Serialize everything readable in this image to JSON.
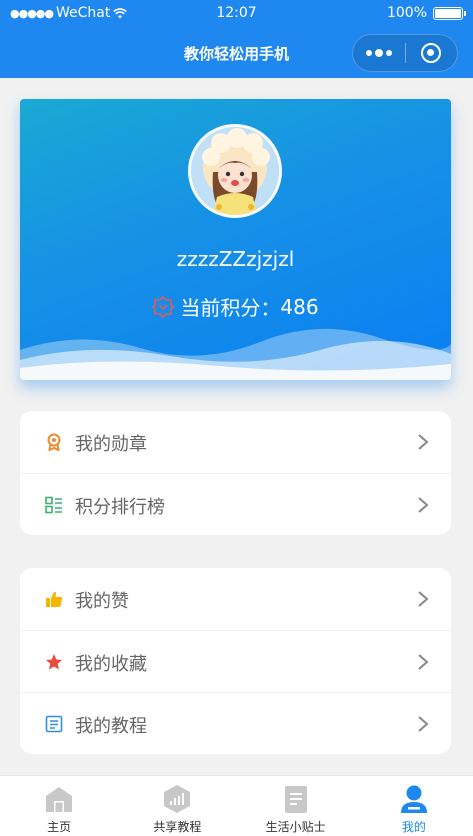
{
  "status_bar": {
    "signal": "●●●●●",
    "carrier": "WeChat",
    "time": "12:07",
    "battery": "100%"
  },
  "navbar": {
    "title": "教你轻松用手机"
  },
  "profile": {
    "username": "zzzzZZzjzjzl",
    "points_label": "当前积分：",
    "points_value": "486"
  },
  "menu_group_1": [
    {
      "label": "我的勋章",
      "icon": "medal-icon",
      "color": "#f08a2c"
    },
    {
      "label": "积分排行榜",
      "icon": "ranking-list-icon",
      "color": "#3cb371"
    }
  ],
  "menu_group_2": [
    {
      "label": "我的赞",
      "icon": "thumbs-up-icon",
      "color": "#f5b400"
    },
    {
      "label": "我的收藏",
      "icon": "star-icon",
      "color": "#e94b3c"
    },
    {
      "label": "我的教程",
      "icon": "tutorial-icon",
      "color": "#2f8fe8"
    }
  ],
  "tabbar": [
    {
      "label": "主页",
      "icon": "home-icon",
      "active": false
    },
    {
      "label": "共享教程",
      "icon": "share-tutorial-icon",
      "active": false
    },
    {
      "label": "生活小贴士",
      "icon": "tips-icon",
      "active": false
    },
    {
      "label": "我的",
      "icon": "profile-icon",
      "active": true
    }
  ],
  "colors": {
    "primary": "#1e88f0",
    "page_bg": "#f1f1f1",
    "tab_inactive_icon": "#c8c8c8"
  }
}
